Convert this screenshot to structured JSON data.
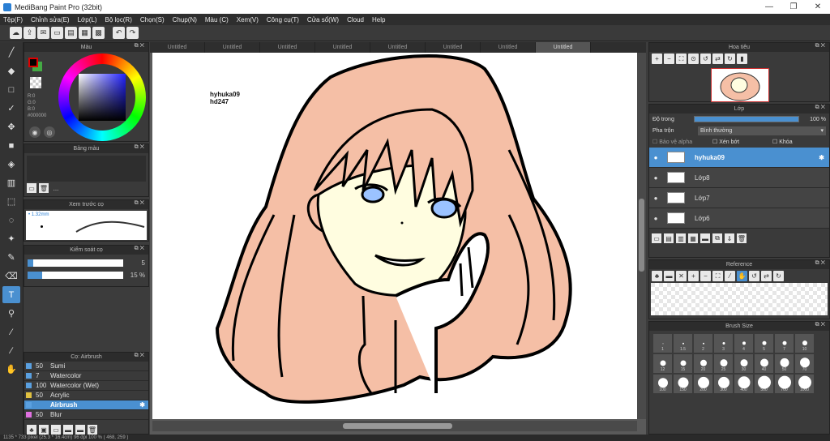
{
  "window": {
    "title": "MediBang Paint Pro (32bit)",
    "controls": [
      "—",
      "❐",
      "✕"
    ]
  },
  "menu": [
    "Tệp(F)",
    "Chỉnh sửa(E)",
    "Lớp(L)",
    "Bộ lọc(R)",
    "Chọn(S)",
    "Chụp(N)",
    "Màu (C)",
    "Xem(V)",
    "Công cụ(T)",
    "Cửa sổ(W)",
    "Cloud",
    "Help"
  ],
  "toolbar": {
    "icons": [
      "cloud-icon",
      "save-icon",
      "chat-icon",
      "new-icon",
      "doc-icon",
      "grid-icon",
      "panel-icon",
      "undo-icon",
      "redo-icon"
    ]
  },
  "tools": [
    "brush-tool",
    "eraser-tool",
    "shape-tool",
    "check-tool",
    "move-tool",
    "fill-tool",
    "bucket-tool",
    "gradient-tool",
    "select-tool",
    "lasso-tool",
    "magic-wand-tool",
    "select-pen-tool",
    "select-eraser-tool",
    "text-tool",
    "operation-tool",
    "eyedropper-tool",
    "dropper-tool",
    "hand-tool"
  ],
  "color_panel": {
    "title": "Màu",
    "r": "R:0",
    "g": "G:0",
    "b": "B:0",
    "hex": "#000000",
    "primary": "#000000",
    "secondary": "#4a4",
    "outline": "#dd0000"
  },
  "palette_panel": {
    "title": "Bảng màu",
    "dots": "..."
  },
  "preview_panel": {
    "title": "Xem trước cọ",
    "size": "1.32mm"
  },
  "control_panel": {
    "title": "Kiểm soát cọ",
    "size_value": "5",
    "size_fill": 0.06,
    "opacity_value": "15 %",
    "opacity_fill": 0.15
  },
  "brush_panel": {
    "title": "Cọ: Airbrush",
    "items": [
      {
        "num": "50",
        "name": "Sumi",
        "color": "#5aa0e0"
      },
      {
        "num": "7",
        "name": "Watercolor",
        "color": "#5aa0e0"
      },
      {
        "num": "100",
        "name": "Watercolor (Wet)",
        "color": "#5aa0e0"
      },
      {
        "num": "50",
        "name": "Acrylic",
        "color": "#e0c040"
      },
      {
        "num": "",
        "name": "Airbrush",
        "color": "#5aa0e0",
        "selected": true
      },
      {
        "num": "50",
        "name": "Blur",
        "color": "#e070e0"
      }
    ]
  },
  "canvas": {
    "tabs": [
      "Untitled",
      "Untitled",
      "Untitled",
      "Untitled",
      "Untitled",
      "Untitled",
      "Untitled",
      "Untitled"
    ],
    "active_tab": 7,
    "signature_line1": "hyhuka09",
    "signature_line2": "hd247"
  },
  "status": {
    "text": "1135 * 733 pixel   (25.3 * 16.4cm)   96 dpi   100 %   ( 468, 259 )"
  },
  "nav_panel": {
    "title": "Hoa tiêu"
  },
  "layer_panel": {
    "title": "Lớp",
    "opacity_label": "Độ trong",
    "opacity_value": "100 %",
    "blend_label": "Pha trộn",
    "blend_value": "Bình thường",
    "protect_alpha": "Bảo vệ alpha",
    "clipping": "Xén bớt",
    "lock": "Khóa",
    "layers": [
      {
        "name": "hyhuka09",
        "selected": true
      },
      {
        "name": "Lớp8"
      },
      {
        "name": "Lớp7"
      },
      {
        "name": "Lớp6"
      }
    ]
  },
  "reference_panel": {
    "title": "Reference"
  },
  "brushsize_panel": {
    "title": "Brush Size",
    "sizes": [
      "1",
      "1.5",
      "2",
      "3",
      "4",
      "5",
      "7",
      "10",
      "12",
      "15",
      "20",
      "25",
      "30",
      "40",
      "50",
      "70",
      "100",
      "150",
      "200",
      "300",
      "400",
      "500",
      "700",
      "1000"
    ]
  }
}
